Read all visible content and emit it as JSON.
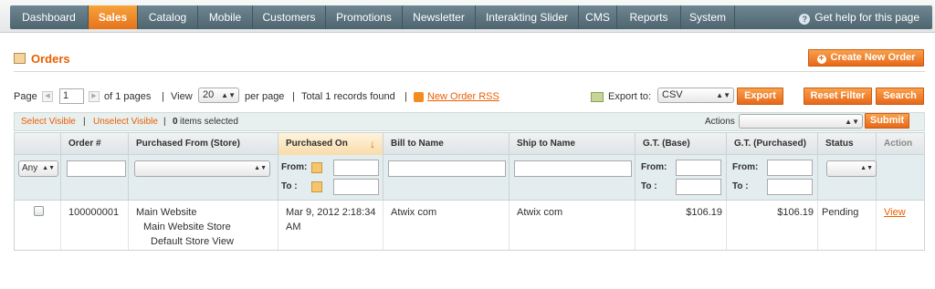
{
  "nav": {
    "items": [
      "Dashboard",
      "Sales",
      "Catalog",
      "Mobile",
      "Customers",
      "Promotions",
      "Newsletter",
      "Interakting Slider",
      "CMS",
      "Reports",
      "System"
    ],
    "active": "Sales",
    "help": "Get help for this page"
  },
  "page": {
    "title": "Orders",
    "create_button": "Create New Order"
  },
  "pager": {
    "page_label": "Page",
    "page_value": "1",
    "of_pages": "of 1 pages",
    "view_label": "View",
    "per_page_value": "20",
    "per_page_label": "per page",
    "total": "Total 1 records found",
    "rss_link": "New Order RSS",
    "export_label": "Export to:",
    "export_value": "CSV",
    "export_button": "Export",
    "reset_button": "Reset Filter",
    "search_button": "Search"
  },
  "massaction": {
    "select_visible": "Select Visible",
    "unselect_visible": "Unselect Visible",
    "items_selected_count": "0",
    "items_selected_label": "items selected",
    "actions_label": "Actions",
    "submit_button": "Submit"
  },
  "grid": {
    "columns": [
      "Order #",
      "Purchased From (Store)",
      "Purchased On",
      "Bill to Name",
      "Ship to Name",
      "G.T. (Base)",
      "G.T. (Purchased)",
      "Status",
      "Action"
    ],
    "filters": {
      "any_value": "Any",
      "from_label": "From:",
      "to_label": "To :"
    },
    "rows": [
      {
        "order": "100000001",
        "store_website": "Main Website",
        "store_group": "Main Website Store",
        "store_view": "Default Store View",
        "purchased_on": "Mar 9, 2012 2:18:34 AM",
        "bill_to": "Atwix com",
        "ship_to": "Atwix com",
        "gt_base": "$106.19",
        "gt_purchased": "$106.19",
        "status": "Pending",
        "action": "View"
      }
    ]
  },
  "colors": {
    "accent": "#eb5e00",
    "nav": "#5a717c",
    "filter_bg": "#e3ecee"
  }
}
